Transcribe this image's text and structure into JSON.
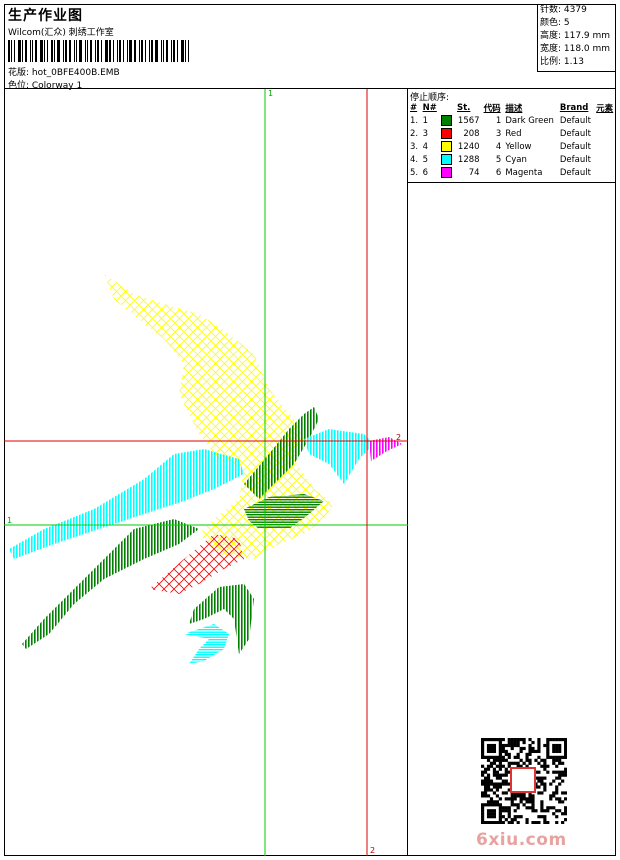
{
  "header": {
    "title": "生产作业图",
    "company": "Wilcom(汇众) 刺绣工作室",
    "design_label": "花版: hot_0BFE400B.EMB",
    "colorway_label": "色位: Colorway 1"
  },
  "stats": [
    "针数: 4379",
    "颜色: 5",
    "高度: 117.9 mm",
    "宽度: 118.0 mm",
    "比例: 1.13"
  ],
  "sequence": {
    "label": "停止顺序:",
    "headers": [
      "#",
      "N#",
      "St.",
      "代码",
      "描述",
      "Brand",
      "元素"
    ],
    "rows": [
      {
        "idx": "1.",
        "n": "1",
        "color": "#008000",
        "st": "1567",
        "code": "1",
        "desc": "Dark Green",
        "brand": "Default"
      },
      {
        "idx": "2.",
        "n": "3",
        "color": "#ff0000",
        "st": "208",
        "code": "3",
        "desc": "Red",
        "brand": "Default"
      },
      {
        "idx": "3.",
        "n": "4",
        "color": "#ffff00",
        "st": "1240",
        "code": "4",
        "desc": "Yellow",
        "brand": "Default"
      },
      {
        "idx": "4.",
        "n": "5",
        "color": "#00ffff",
        "st": "1288",
        "code": "5",
        "desc": "Cyan",
        "brand": "Default"
      },
      {
        "idx": "5.",
        "n": "6",
        "color": "#ff00ff",
        "st": "74",
        "code": "6",
        "desc": "Magenta",
        "brand": "Default"
      }
    ]
  },
  "axes": {
    "green_label": "1",
    "red_label": "2",
    "green_color": "#00cc00",
    "red_color": "#dd0000"
  },
  "watermark": "6xiu.com",
  "qr_icon": "qr-code-icon"
}
